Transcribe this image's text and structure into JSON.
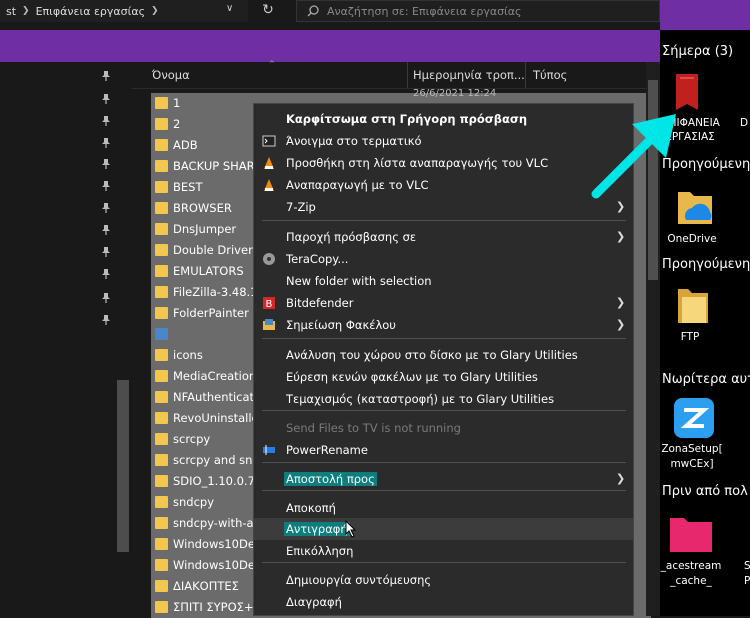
{
  "address": {
    "prefix": "st",
    "path": "Επιφάνεια εργασίας"
  },
  "search": {
    "placeholder": "Αναζήτηση σε: Επιφάνεια εργασίας"
  },
  "columns": {
    "name": "Όνομα",
    "date": "Ημερομηνία τροπ...",
    "type": "Τύπος"
  },
  "files": [
    {
      "name": "1",
      "icon": "folder",
      "selected": true
    },
    {
      "name": "2",
      "icon": "folder",
      "selected": true
    },
    {
      "name": "ADB",
      "icon": "folder",
      "selected": true
    },
    {
      "name": "BACKUP SHAR",
      "icon": "folder",
      "selected": true
    },
    {
      "name": "BEST",
      "icon": "folder",
      "selected": true
    },
    {
      "name": "BROWSER",
      "icon": "folder",
      "selected": true
    },
    {
      "name": "DnsJumper",
      "icon": "folder",
      "selected": true
    },
    {
      "name": "Double Driver",
      "icon": "folder",
      "selected": true
    },
    {
      "name": "EMULATORS",
      "icon": "folder",
      "selected": true
    },
    {
      "name": "FileZilla-3.48.1",
      "icon": "folder",
      "selected": true
    },
    {
      "name": "FolderPainter",
      "icon": "folder",
      "selected": true
    },
    {
      "name": "",
      "icon": "control-panel",
      "selected": true
    },
    {
      "name": "icons",
      "icon": "folder",
      "selected": true
    },
    {
      "name": "MediaCreation",
      "icon": "folder",
      "selected": true
    },
    {
      "name": "NFAuthenticati",
      "icon": "folder",
      "selected": true
    },
    {
      "name": "RevoUninstalle",
      "icon": "folder",
      "selected": true
    },
    {
      "name": "scrcpy",
      "icon": "folder",
      "selected": true
    },
    {
      "name": "scrcpy and snd",
      "icon": "folder",
      "selected": true
    },
    {
      "name": "SDIO_1.10.0.72",
      "icon": "folder",
      "selected": true
    },
    {
      "name": "sndcpy",
      "icon": "folder",
      "selected": true
    },
    {
      "name": "sndcpy-with-a",
      "icon": "folder",
      "selected": true
    },
    {
      "name": "Windows10Deb",
      "icon": "folder",
      "selected": true
    },
    {
      "name": "Windows10Deb",
      "icon": "folder",
      "selected": true
    },
    {
      "name": "ΔΙΑΚΟΠΤΕΣ",
      "icon": "folder",
      "selected": true
    },
    {
      "name": "ΣΠΙΤΙ ΣΥΡΟΣ+Α",
      "icon": "folder",
      "selected": true
    }
  ],
  "first_row_partial": "26/6/2021 12:24",
  "context_menu": {
    "items": [
      {
        "label": "Καρφίτσωμα στη Γρήγορη πρόσβαση",
        "bold": true,
        "icon": ""
      },
      {
        "label": "Άνοιγμα στο τερματικό",
        "icon": "terminal-icon"
      },
      {
        "label": "Προσθήκη στη λίστα αναπαραγωγής του VLC",
        "icon": "vlc-icon"
      },
      {
        "label": "Αναπαραγωγή με το VLC",
        "icon": "vlc-icon"
      },
      {
        "label": "7-Zip",
        "submenu": true,
        "icon": ""
      },
      {
        "sep": true
      },
      {
        "label": "Παροχή πρόσβασης σε",
        "submenu": true,
        "icon": ""
      },
      {
        "label": "TeraCopy...",
        "icon": "teracopy-icon"
      },
      {
        "label": "New folder with selection",
        "icon": ""
      },
      {
        "label": "Bitdefender",
        "submenu": true,
        "icon": "bitdefender-icon"
      },
      {
        "label": "Σημείωση Φακέλου",
        "submenu": true,
        "icon": "folder-note-icon"
      },
      {
        "sep": true
      },
      {
        "label": "Ανάλυση του χώρου στο δίσκο με το Glary Utilities",
        "icon": ""
      },
      {
        "label": "Εύρεση κενών φακέλων με το Glary Utilities",
        "icon": ""
      },
      {
        "label": "Τεμαχισμός (καταστροφή) με το Glary Utilities",
        "icon": ""
      },
      {
        "sep": true
      },
      {
        "label": "Send Files to TV is not running",
        "disabled": true,
        "icon": ""
      },
      {
        "label": "PowerRename",
        "icon": "powerrename-icon"
      },
      {
        "sep": true
      },
      {
        "label": "Αποστολή προς",
        "submenu": true,
        "highlight": true,
        "icon": ""
      },
      {
        "sep": true
      },
      {
        "label": "Αποκοπή",
        "icon": ""
      },
      {
        "label": "Αντιγραφή",
        "highlight": true,
        "hover": true,
        "icon": ""
      },
      {
        "label": "Επικόλληση",
        "icon": ""
      },
      {
        "sep": true
      },
      {
        "label": "Δημιουργία συντόμευσης",
        "icon": ""
      },
      {
        "label": "Διαγραφή",
        "icon": ""
      }
    ]
  },
  "desktop": {
    "today_title": "Σήμερα (3)",
    "today_icon_label_1": "ΕΠΙΦΑΝΕΙΑ",
    "today_icon_label_2": "ΕΡΓΑΣΙΑΣ",
    "today_extra": "D",
    "prev1_title": "Προηγούμενη",
    "onedrive_label": "OneDrive",
    "prev2_title": "Προηγούμενη",
    "ftp_label": "FTP",
    "earlier_title": "Νωρίτερα αυτ",
    "zona_label_1": "ZonaSetup[",
    "zona_label_2": "mwCEx]",
    "before_title": "Πριν από πολ",
    "ace_label_1": "_acestream",
    "ace_label_2": "_cache_",
    "ace_extra_1": "S",
    "ace_extra_2": "P"
  },
  "colors": {
    "accent_purple": "#6f2ea4",
    "arrow_cyan": "#00e5e5",
    "teal_highlight": "#0d7d7d",
    "folder_yellow": "#f3c74e"
  }
}
